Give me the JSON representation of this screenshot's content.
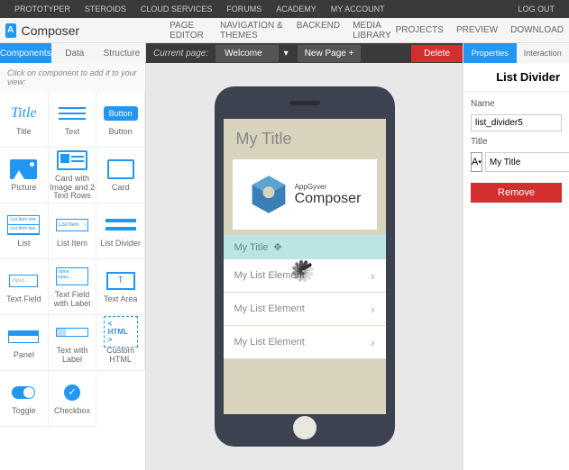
{
  "topnav": {
    "items": [
      "PROTOTYPER",
      "STEROIDS",
      "CLOUD SERVICES",
      "FORUMS",
      "ACADEMY",
      "MY ACCOUNT"
    ],
    "logout": "LOG OUT"
  },
  "header": {
    "logo_badge": "A",
    "logo_text": "Composer",
    "subnav": [
      "PAGE EDITOR",
      "NAVIGATION & THEMES",
      "BACKEND",
      "MEDIA LIBRARY"
    ],
    "rightnav": [
      "PROJECTS",
      "PREVIEW",
      "DOWNLOAD"
    ]
  },
  "left": {
    "tabs": [
      "Components",
      "Data",
      "Structure"
    ],
    "hint": "Click on component to add it to your view:",
    "items": [
      "Title",
      "Text",
      "Button",
      "Picture",
      "Card with Image and 2 Text Rows",
      "Card",
      "List",
      "List Item",
      "List Divider",
      "Text Field",
      "Text Field with Label",
      "Text Area",
      "Panel",
      "Text with Label",
      "Custom HTML",
      "Toggle",
      "Checkbox"
    ],
    "btn_label": "Button",
    "html_label": "< HTML >"
  },
  "pagebar": {
    "label": "Current page:",
    "selected": "Welcome",
    "new": "New Page +",
    "delete": "Delete"
  },
  "phone": {
    "title": "My Title",
    "logo_top": "AppGyver",
    "logo_main": "Composer",
    "divider": "My Title",
    "rows": [
      "My List Element",
      "My List Element",
      "My List Element"
    ]
  },
  "right": {
    "tabs": [
      "Properties",
      "Interaction"
    ],
    "title": "List Divider",
    "name_label": "Name",
    "name_value": "list_divider5",
    "title_label": "Title",
    "title_value": "My Title",
    "format_letter": "A",
    "remove": "Remove"
  }
}
